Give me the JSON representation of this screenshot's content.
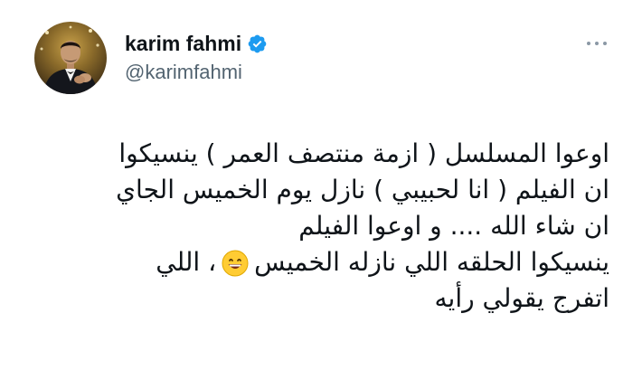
{
  "tweet": {
    "author": {
      "display_name": "karim fahmi",
      "handle": "@karimfahmi",
      "verified": true,
      "avatar": "profile-photo"
    },
    "more_icon": "more-horizontal-icon",
    "body": {
      "line1": "اوعوا المسلسل ( ازمة منتصف العمر ) ينسيكوا",
      "line2": "ان الفيلم ( انا لحبيبي )  نازل يوم الخميس الجاي",
      "line3": "ان شاء الله .... و اوعوا الفيلم",
      "line4_part1": "ينسيكوا الحلقه اللي نازله الخميس",
      "line4_emoji": "😄",
      "line4_part2": "، اللي",
      "line5": "اتفرج يقولي رأيه"
    },
    "colors": {
      "text_primary": "#0f1419",
      "text_secondary": "#536471",
      "verified_blue": "#1d9bf0",
      "background": "#ffffff"
    }
  }
}
